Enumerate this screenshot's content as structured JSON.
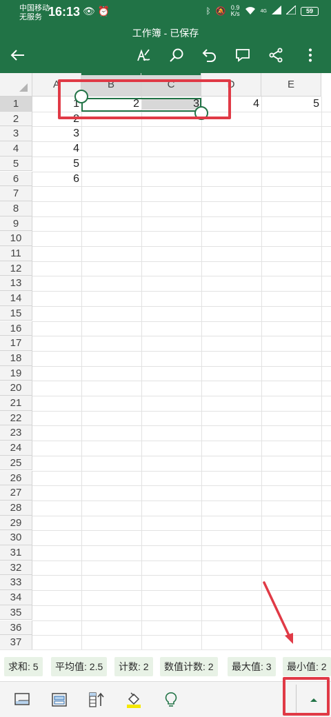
{
  "status_bar": {
    "carrier_line1": "中国移动",
    "carrier_line2": "无服务",
    "time": "16:13",
    "net_speed_value": "0.9",
    "net_speed_unit": "K/s",
    "network_badge": "4G",
    "battery": "59"
  },
  "header": {
    "title": "工作簿 - 已保存",
    "icons": [
      "back-arrow-icon",
      "draw-pen-icon",
      "search-icon",
      "undo-icon",
      "comment-icon",
      "share-icon",
      "more-vertical-icon"
    ]
  },
  "sheet": {
    "columns": [
      "A",
      "B",
      "C",
      "D",
      "E"
    ],
    "selected_columns": [
      "B",
      "C"
    ],
    "rows": [
      "1",
      "2",
      "3",
      "4",
      "5",
      "6",
      "7",
      "8",
      "9",
      "10",
      "11",
      "12",
      "13",
      "14",
      "15",
      "16",
      "17",
      "18",
      "19",
      "20",
      "21",
      "22",
      "23",
      "24",
      "25",
      "26",
      "27",
      "28",
      "29",
      "30",
      "31",
      "32",
      "33",
      "34",
      "35",
      "36",
      "37"
    ],
    "selected_row": "1",
    "cells": {
      "A1": "1",
      "B1": "2",
      "C1": "3",
      "D1": "4",
      "E1": "5",
      "A2": "2",
      "A3": "3",
      "A4": "4",
      "A5": "5",
      "A6": "6"
    },
    "selection_range": "B1:C1"
  },
  "summary": {
    "sum": "求和: 5",
    "average": "平均值: 2.5",
    "count": "计数: 2",
    "numeric_count": "数值计数: 2",
    "max": "最大值: 3",
    "min": "最小值: 2"
  },
  "bottom_toolbar": {
    "icons": [
      "freeze-panes-icon",
      "card-view-icon",
      "sort-column-icon",
      "fill-color-icon",
      "lightbulb-icon",
      "expand-up-icon"
    ],
    "fill_color": "#f5e800"
  },
  "colors": {
    "excel_green": "#217346",
    "annotation_red": "#e03a46"
  }
}
